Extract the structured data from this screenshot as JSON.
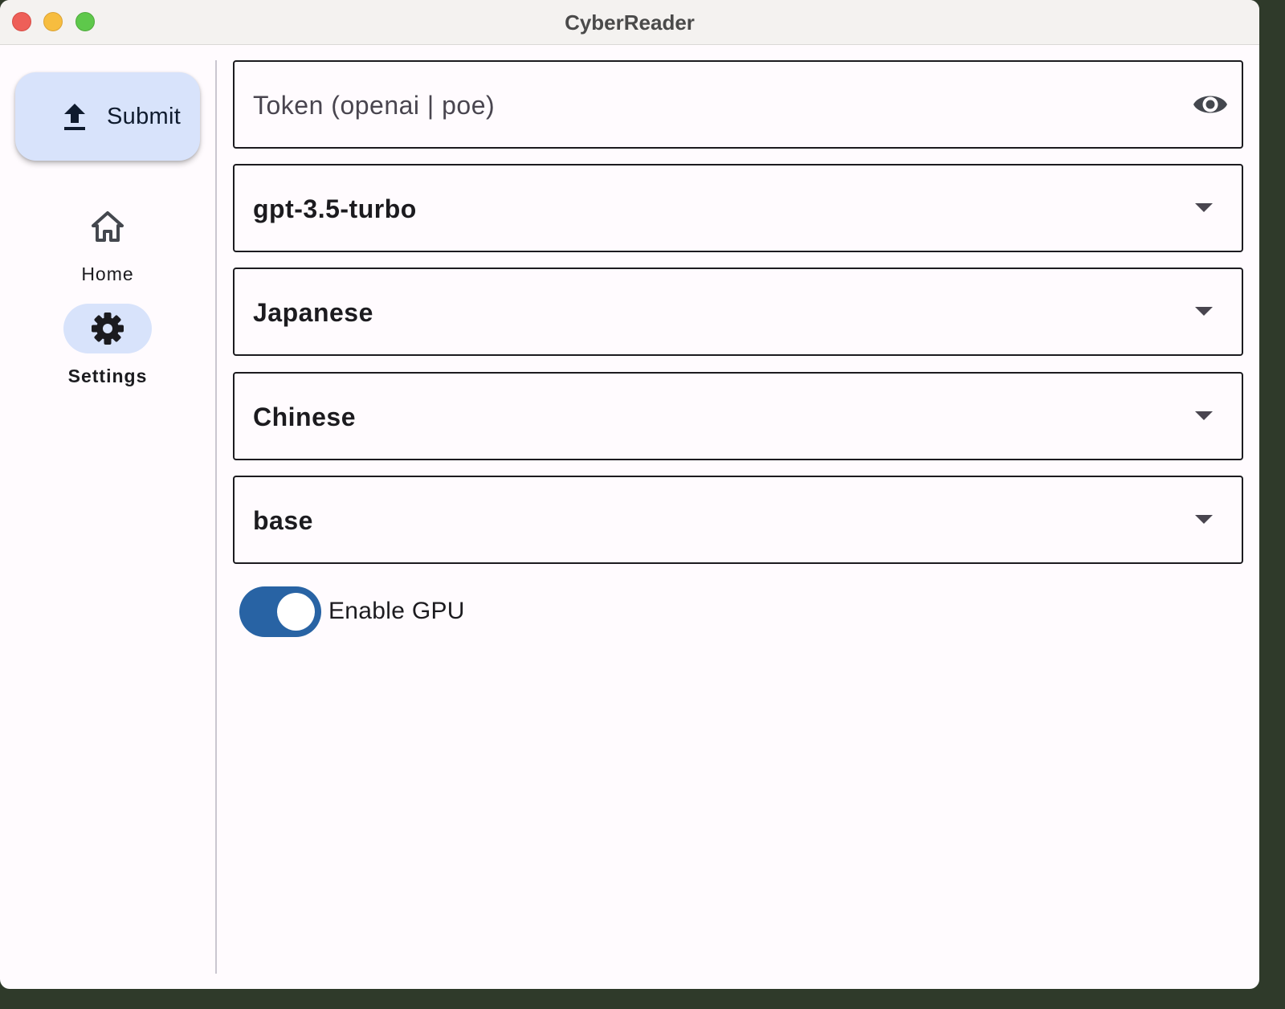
{
  "window": {
    "title": "CyberReader"
  },
  "sidebar": {
    "fab": {
      "label": "Submit",
      "icon": "upload-icon"
    },
    "items": [
      {
        "label": "Home",
        "icon": "home-icon",
        "active": false
      },
      {
        "label": "Settings",
        "icon": "gear-icon",
        "active": true
      }
    ]
  },
  "settings": {
    "token": {
      "value": "",
      "placeholder": "Token (openai | poe)",
      "icon": "eye-icon"
    },
    "model": {
      "selected": "gpt-3.5-turbo"
    },
    "source_language": {
      "selected": "Japanese"
    },
    "target_language": {
      "selected": "Chinese"
    },
    "whisper_model": {
      "selected": "base"
    },
    "gpu": {
      "label": "Enable GPU",
      "enabled": true
    }
  },
  "colors": {
    "accent": "#2863a4",
    "nav_indicator": "#d8e3fb",
    "close": "#ee5f58",
    "minimize": "#f7bd3f",
    "maximize": "#5ec84b"
  }
}
